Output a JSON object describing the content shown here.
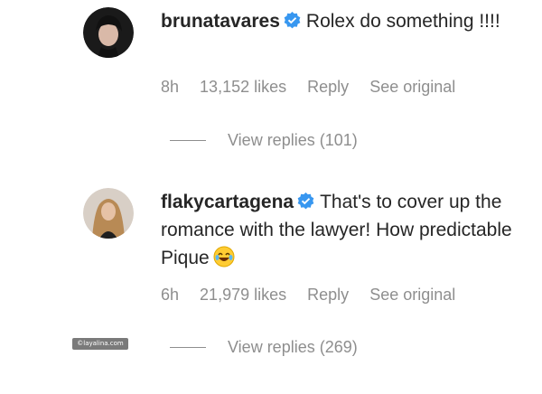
{
  "comments": [
    {
      "username": "brunatavares",
      "text": "Rolex do something !!!!",
      "time": "8h",
      "likes": "13,152 likes",
      "reply": "Reply",
      "see_original": "See original",
      "view_replies": "View replies (101)",
      "verified_icon": "verified-badge-icon",
      "avatar_icon": "avatar"
    },
    {
      "username": "flakycartagena",
      "text": "That's to cover up the romance with the lawyer! How predictable Pique",
      "time": "6h",
      "likes": "21,979 likes",
      "reply": "Reply",
      "see_original": "See original",
      "view_replies": "View replies (269)",
      "verified_icon": "verified-badge-icon",
      "emoji": "laughing-crying-emoji",
      "avatar_icon": "avatar"
    }
  ],
  "watermark": "©layalina.com",
  "colors": {
    "text": "#262626",
    "muted": "#8e8e8e",
    "verified": "#3897f0"
  }
}
